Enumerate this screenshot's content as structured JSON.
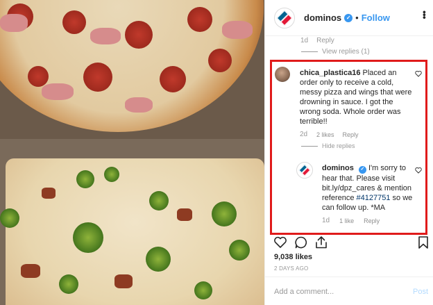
{
  "header": {
    "username": "dominos",
    "follow_separator": "•",
    "follow_label": "Follow",
    "verified_glyph": "✓",
    "more_icon": "more-icon"
  },
  "previous_comment": {
    "age": "1d",
    "reply_label": "Reply",
    "view_replies": "View replies (1)"
  },
  "comment": {
    "username": "chica_plastica16",
    "text": "Placed an order only to receive a cold, messy pizza and wings that were drowning in sauce. I got the wrong soda. Whole order was terrible!!",
    "age": "2d",
    "likes": "2 likes",
    "reply_label": "Reply",
    "hide_replies": "Hide replies"
  },
  "reply": {
    "username": "dominos",
    "text_before": "I'm sorry to hear that. Please visit bit.ly/dpz_cares & mention reference ",
    "reference_link": "#4127751",
    "text_after": " so we can follow up. *MA",
    "age": "1d",
    "likes": "1 like",
    "reply_label": "Reply"
  },
  "post": {
    "likes": "9,038 likes",
    "posted": "2 DAYS AGO",
    "add_comment_placeholder": "Add a comment...",
    "post_label": "Post"
  },
  "colors": {
    "highlight_border": "#e01b1b",
    "link": "#3897f0",
    "brand_blue": "#006491",
    "brand_red": "#e31837"
  }
}
